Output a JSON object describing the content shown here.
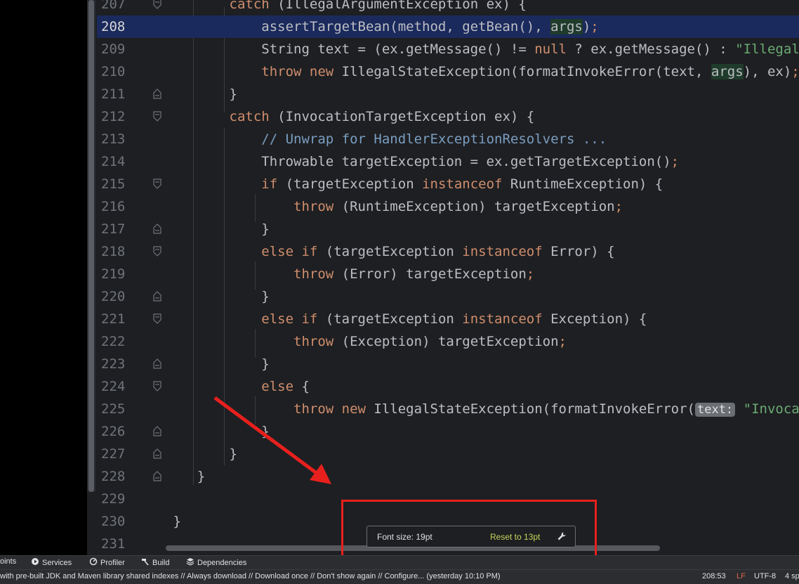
{
  "editor": {
    "current_line": 208,
    "lines": [
      {
        "no": "207",
        "fold": "open",
        "tokens": [
          {
            "t": "        "
          },
          {
            "t": "catch",
            "c": "kw"
          },
          {
            "t": " (IllegalArgumentException ex) {"
          }
        ]
      },
      {
        "no": "208",
        "fold": "",
        "current": true,
        "tokens": [
          {
            "t": "            assertTargetBean(method, getBean(), "
          },
          {
            "t": "args",
            "c": "ref"
          },
          {
            "t": ")"
          },
          {
            "t": ";",
            "c": "kw"
          }
        ]
      },
      {
        "no": "209",
        "fold": "",
        "tokens": [
          {
            "t": "            String text = (ex.getMessage() != "
          },
          {
            "t": "null",
            "c": "kw"
          },
          {
            "t": " ? ex.getMessage() : "
          },
          {
            "t": "\"Illegal argument\"",
            "c": "str"
          }
        ]
      },
      {
        "no": "210",
        "fold": "",
        "tokens": [
          {
            "t": "            "
          },
          {
            "t": "throw new",
            "c": "kw"
          },
          {
            "t": " IllegalStateException(formatInvokeError(text, "
          },
          {
            "t": "args",
            "c": "ref"
          },
          {
            "t": "), ex)"
          },
          {
            "t": ";",
            "c": "kw"
          }
        ]
      },
      {
        "no": "211",
        "fold": "close",
        "tokens": [
          {
            "t": "        }"
          }
        ]
      },
      {
        "no": "212",
        "fold": "open",
        "tokens": [
          {
            "t": "        "
          },
          {
            "t": "catch",
            "c": "kw"
          },
          {
            "t": " (InvocationTargetException ex) {"
          }
        ]
      },
      {
        "no": "213",
        "fold": "",
        "tokens": [
          {
            "t": "            "
          },
          {
            "t": "// Unwrap for HandlerExceptionResolvers ...",
            "c": "cmt"
          }
        ]
      },
      {
        "no": "214",
        "fold": "",
        "tokens": [
          {
            "t": "            Throwable targetException = ex.getTargetException()"
          },
          {
            "t": ";",
            "c": "kw"
          }
        ]
      },
      {
        "no": "215",
        "fold": "open",
        "tokens": [
          {
            "t": "            "
          },
          {
            "t": "if",
            "c": "kw"
          },
          {
            "t": " (targetException "
          },
          {
            "t": "instanceof",
            "c": "kw"
          },
          {
            "t": " RuntimeException) {"
          }
        ]
      },
      {
        "no": "216",
        "fold": "",
        "tokens": [
          {
            "t": "                "
          },
          {
            "t": "throw",
            "c": "kw"
          },
          {
            "t": " (RuntimeException) targetException"
          },
          {
            "t": ";",
            "c": "kw"
          }
        ]
      },
      {
        "no": "217",
        "fold": "close",
        "tokens": [
          {
            "t": "            }"
          }
        ]
      },
      {
        "no": "218",
        "fold": "open",
        "tokens": [
          {
            "t": "            "
          },
          {
            "t": "else if",
            "c": "kw"
          },
          {
            "t": " (targetException "
          },
          {
            "t": "instanceof",
            "c": "kw"
          },
          {
            "t": " Error) {"
          }
        ]
      },
      {
        "no": "219",
        "fold": "",
        "tokens": [
          {
            "t": "                "
          },
          {
            "t": "throw",
            "c": "kw"
          },
          {
            "t": " (Error) targetException"
          },
          {
            "t": ";",
            "c": "kw"
          }
        ]
      },
      {
        "no": "220",
        "fold": "close",
        "tokens": [
          {
            "t": "            }"
          }
        ]
      },
      {
        "no": "221",
        "fold": "open",
        "tokens": [
          {
            "t": "            "
          },
          {
            "t": "else if",
            "c": "kw"
          },
          {
            "t": " (targetException "
          },
          {
            "t": "instanceof",
            "c": "kw"
          },
          {
            "t": " Exception) {"
          }
        ]
      },
      {
        "no": "222",
        "fold": "",
        "tokens": [
          {
            "t": "                "
          },
          {
            "t": "throw",
            "c": "kw"
          },
          {
            "t": " (Exception) targetException"
          },
          {
            "t": ";",
            "c": "kw"
          }
        ]
      },
      {
        "no": "223",
        "fold": "close",
        "tokens": [
          {
            "t": "            }"
          }
        ]
      },
      {
        "no": "224",
        "fold": "open",
        "tokens": [
          {
            "t": "            "
          },
          {
            "t": "else",
            "c": "kw"
          },
          {
            "t": " {"
          }
        ]
      },
      {
        "no": "225",
        "fold": "",
        "tokens": [
          {
            "t": "                "
          },
          {
            "t": "throw new",
            "c": "kw"
          },
          {
            "t": " IllegalStateException(formatInvokeError("
          },
          {
            "t": "text:",
            "c": "hint"
          },
          {
            "t": " "
          },
          {
            "t": "\"Invocation failure\"",
            "c": "str"
          }
        ]
      },
      {
        "no": "226",
        "fold": "close",
        "tokens": [
          {
            "t": "            }"
          }
        ]
      },
      {
        "no": "227",
        "fold": "close",
        "tokens": [
          {
            "t": "        }"
          }
        ]
      },
      {
        "no": "228",
        "fold": "close",
        "tokens": [
          {
            "t": "    }"
          }
        ]
      },
      {
        "no": "229",
        "fold": "",
        "tokens": []
      },
      {
        "no": "230",
        "fold": "",
        "tokens": [
          {
            "t": " }"
          }
        ]
      },
      {
        "no": "231",
        "fold": "",
        "tokens": []
      }
    ]
  },
  "toolbar": {
    "breakpoints_label": "oints",
    "services_label": "Services",
    "profiler_label": "Profiler",
    "build_label": "Build",
    "dependencies_label": "Dependencies"
  },
  "status_bar": {
    "message": "with pre-built JDK and Maven library shared indexes // Always download // Download once // Don't show again // Configure... (yesterday 10:10 PM)",
    "position": "208:53",
    "line_separator": "LF",
    "encoding": "UTF-8",
    "indent": "4 sp"
  },
  "font_popup": {
    "label": "Font size: 19pt",
    "reset_label": "Reset to 13pt",
    "icon": "wrench-icon"
  },
  "colors": {
    "keyword": "#cf8e6d",
    "string": "#6aab73",
    "comment": "#7a9ec2",
    "current_line": "#1b2a5c",
    "reset_link": "#c7d45b",
    "annotation": "#e8201d"
  }
}
